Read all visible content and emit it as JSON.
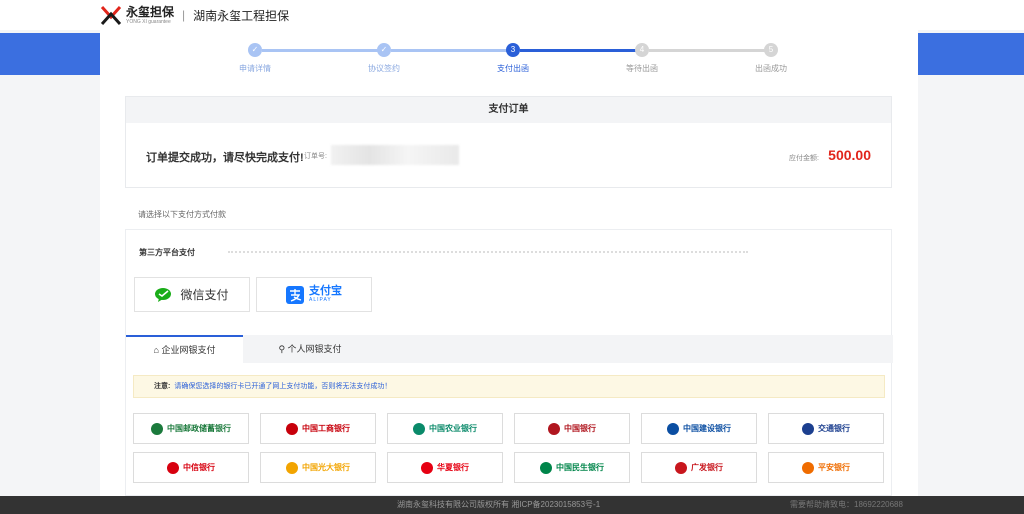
{
  "header": {
    "brand_cn": "永玺担保",
    "brand_en": "YONG XI guarantee",
    "separator": "|",
    "company": "湖南永玺工程担保"
  },
  "steps": [
    {
      "number": "✓",
      "label": "申请详情",
      "status": "done"
    },
    {
      "number": "✓",
      "label": "协议签约",
      "status": "done"
    },
    {
      "number": "3",
      "label": "支付出函",
      "status": "active"
    },
    {
      "number": "4",
      "label": "等待出函",
      "status": "todo"
    },
    {
      "number": "5",
      "label": "出函成功",
      "status": "todo"
    }
  ],
  "order": {
    "panel_title": "支付订单",
    "message": "订单提交成功，请尽快完成支付!",
    "order_no_label": "订单号:",
    "amount_label": "应付金额:",
    "amount": "500.00"
  },
  "payment": {
    "hint": "请选择以下支付方式付款",
    "third_party_title": "第三方平台支付",
    "wechat_label": "微信支付",
    "alipay_cn": "支付宝",
    "alipay_en": "ALIPAY",
    "tabs": [
      "企业网银支付",
      "个人网银支付"
    ],
    "notice_label": "注意:",
    "notice_text": "请确保您选择的银行卡已开通了网上支付功能，否则将无法支付成功！"
  },
  "banks": [
    {
      "name": "中国邮政储蓄银行",
      "color": "#1b7a3c"
    },
    {
      "name": "中国工商银行",
      "color": "#c7000b"
    },
    {
      "name": "中国农业银行",
      "color": "#0a8a6a"
    },
    {
      "name": "中国银行",
      "color": "#b0161f"
    },
    {
      "name": "中国建设银行",
      "color": "#0b4ea2"
    },
    {
      "name": "交通银行",
      "color": "#1c3f8f"
    },
    {
      "name": "中信银行",
      "color": "#d7000f"
    },
    {
      "name": "中国光大银行",
      "color": "#f2a400"
    },
    {
      "name": "华夏银行",
      "color": "#e60012"
    },
    {
      "name": "中国民生银行",
      "color": "#00854a"
    },
    {
      "name": "广发银行",
      "color": "#c8161d"
    },
    {
      "name": "平安银行",
      "color": "#ef6c00"
    }
  ],
  "footer": {
    "copyright": "湖南永玺科技有限公司版权所有 湘ICP备2023015853号-1",
    "help": "需要帮助请致电：18692220688"
  },
  "colors": {
    "accent": "#2a5fd8",
    "amount": "#e1251b",
    "side_band": "#3b6fe0"
  }
}
